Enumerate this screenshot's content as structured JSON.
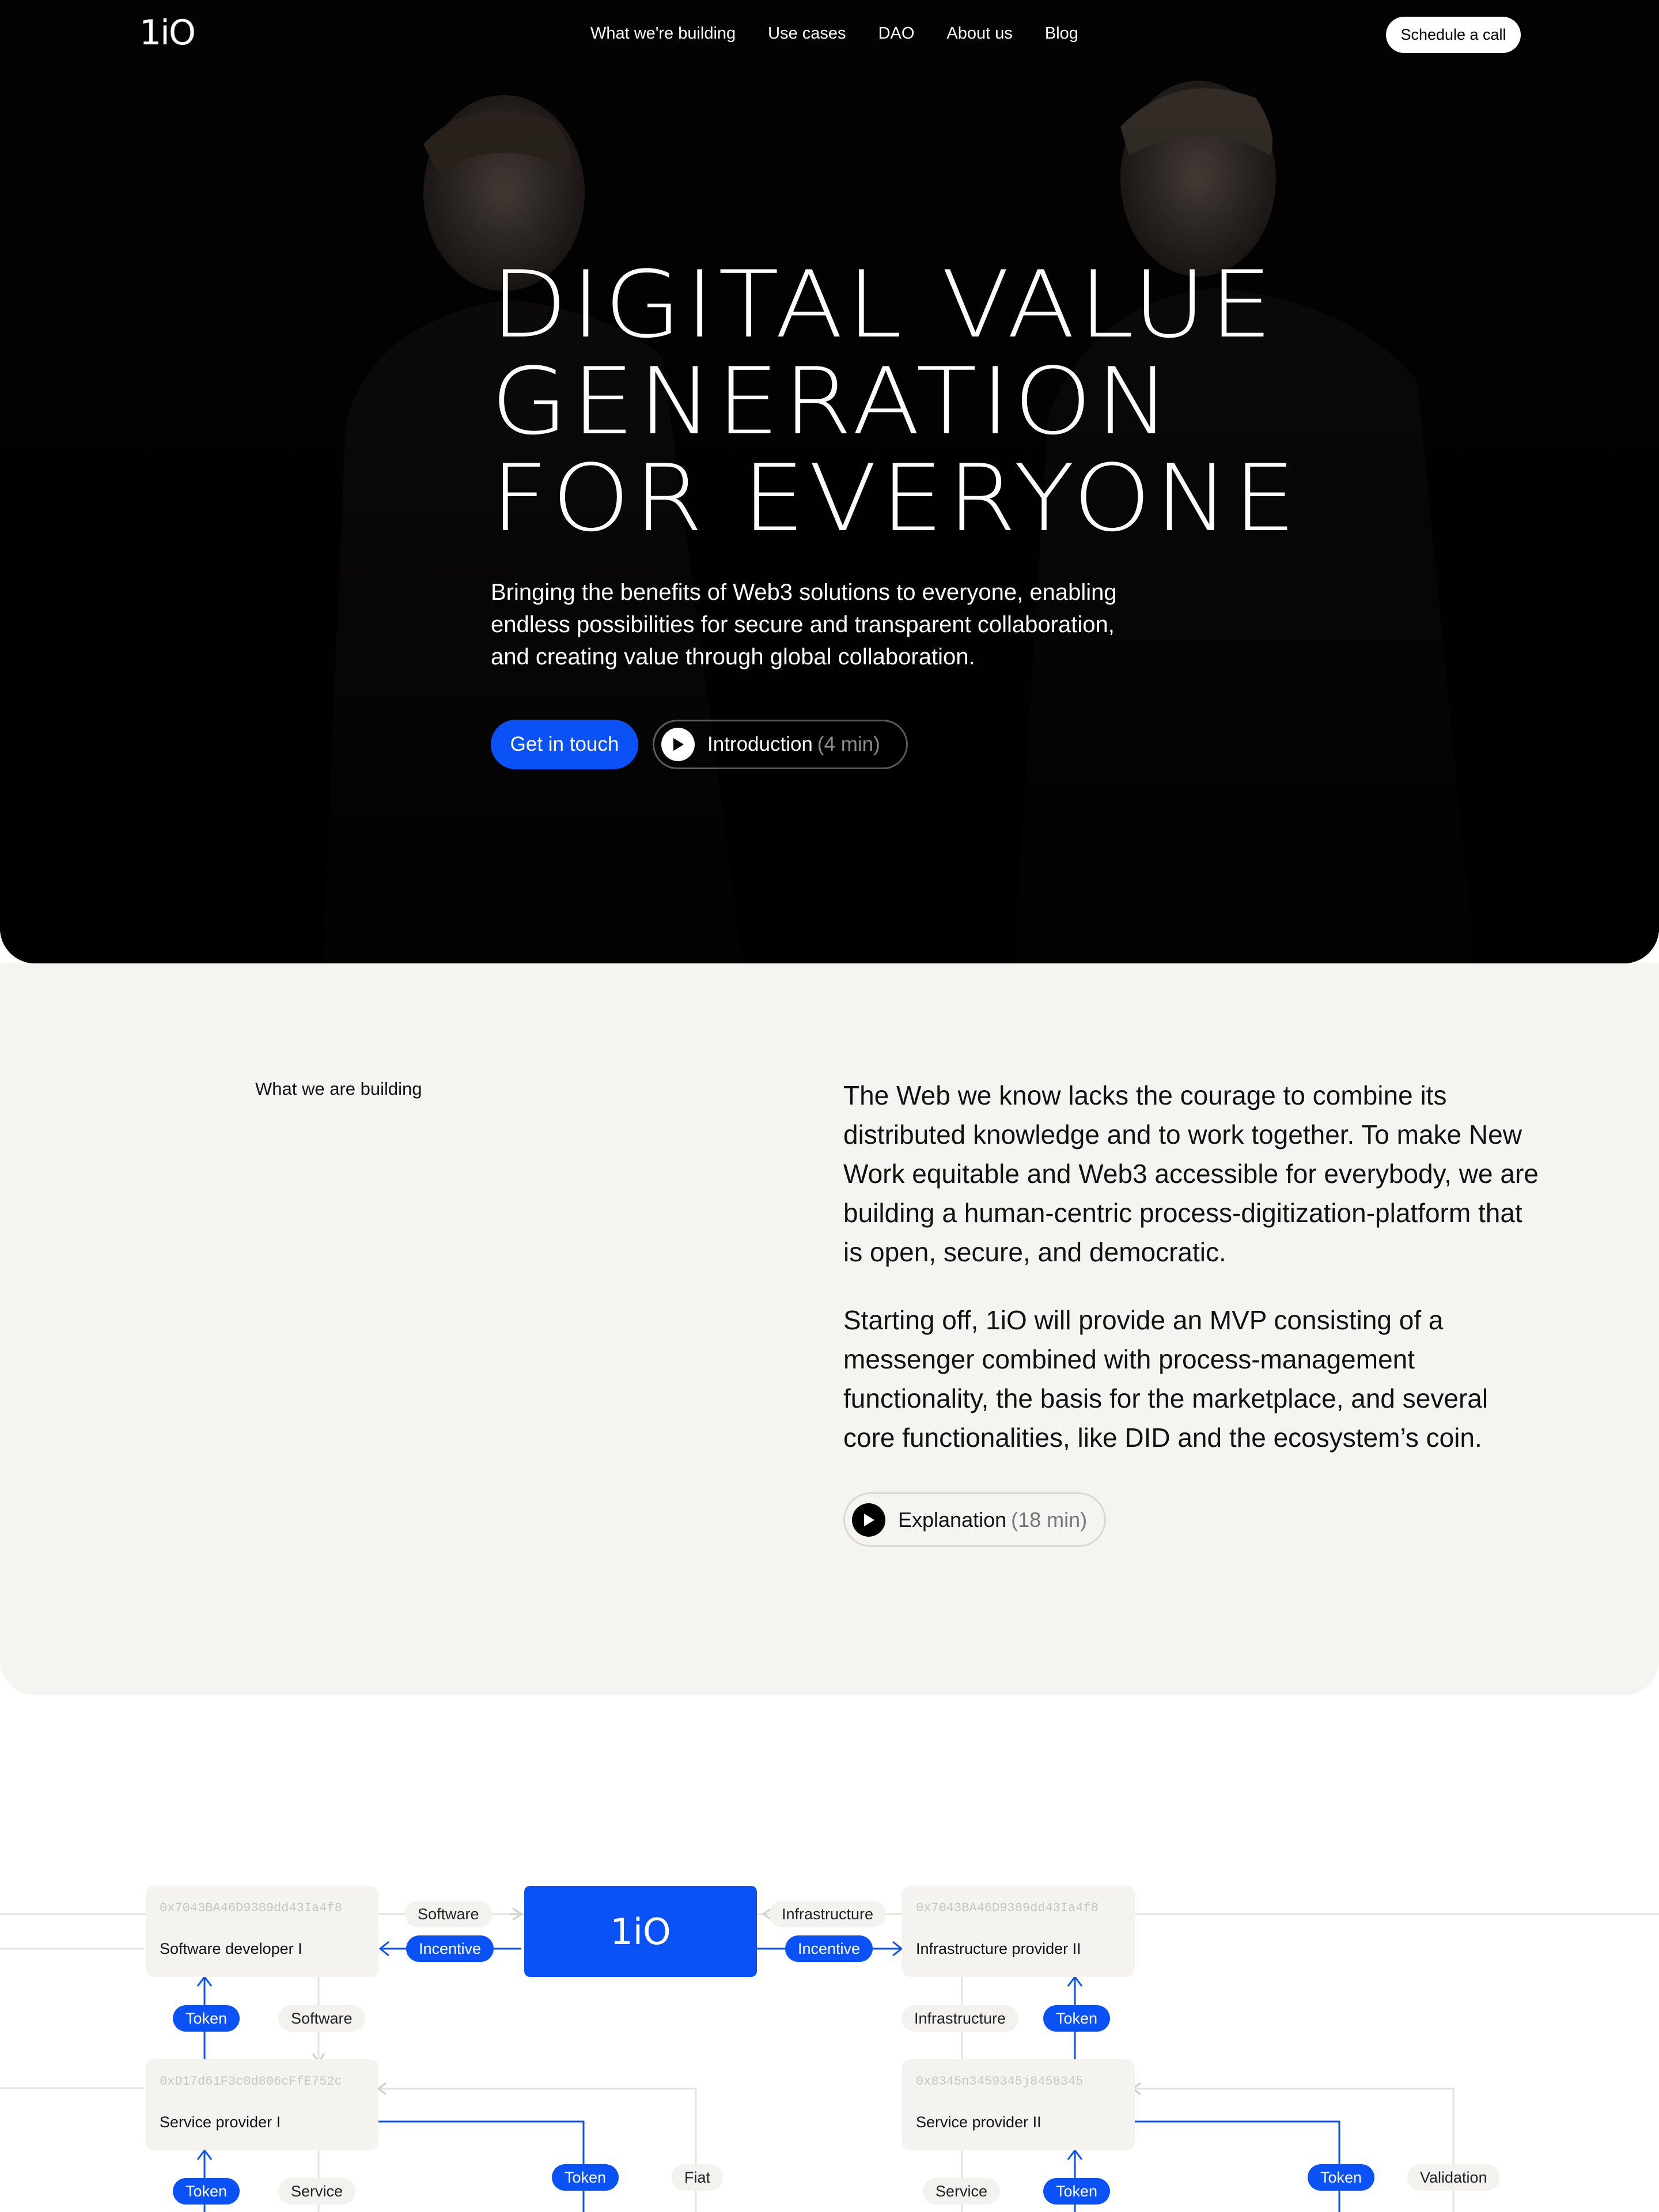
{
  "nav": {
    "logo": "1iO",
    "links": [
      "What we're building",
      "Use cases",
      "DAO",
      "About us",
      "Blog"
    ],
    "cta": "Schedule a call"
  },
  "hero": {
    "title_lines": [
      "DIGITAL VALUE",
      "GENERATION",
      "FOR EVERYONE"
    ],
    "subtitle": "Bringing the benefits of Web3 solutions to everyone, enabling endless possibilities for secure and transparent collaboration, and creating value through global collaboration.",
    "primary_button": "Get in touch",
    "video_button": {
      "label": "Introduction",
      "duration": "(4 min)"
    }
  },
  "building": {
    "label": "What we are building",
    "paragraph1": "The Web we know lacks the courage to combine its distributed knowledge and to work together. To make New Work equitable and Web3 accessible for everybody, we are building a human-centric process-digitization-platform that is open, secure, and democratic.",
    "paragraph2": "Starting off, 1iO will provide an MVP consisting of a messenger combined with process-management functionality, the basis for the marketplace, and several core functionalities, like DID and the ecosystem’s coin.",
    "video_button": {
      "label": "Explanation",
      "duration": "(18 min)"
    }
  },
  "diagram": {
    "center": "1iO",
    "nodes": {
      "software_developer": {
        "hash": "0x7043BA46D9389dd43Ia4f8",
        "title": "Software developer I"
      },
      "infrastructure_provider": {
        "hash": "0x7043BA46D9389dd43Ia4f8",
        "title": "Infrastructure provider II"
      },
      "service_provider_1": {
        "hash": "0xD17d61F3c0d806cFfE752c",
        "title": "Service provider I"
      },
      "service_provider_2": {
        "hash": "0x8345n3459345j8458345",
        "title": "Service provider II"
      }
    },
    "labels": {
      "software": "Software",
      "incentive": "Incentive",
      "infrastructure": "Infrastructure",
      "token": "Token",
      "service": "Service",
      "fiat": "Fiat",
      "validation": "Validation"
    }
  },
  "colors": {
    "accent": "#0a52f5",
    "hero_bg": "#000000",
    "section_bg": "#f5f4f1"
  }
}
